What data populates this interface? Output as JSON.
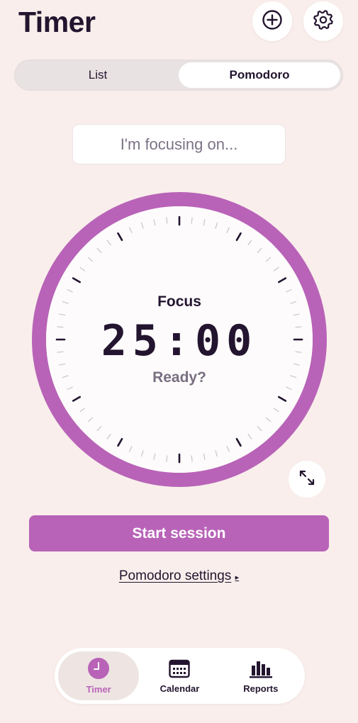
{
  "header": {
    "title": "Timer",
    "add_icon": "plus-circle-icon",
    "settings_icon": "gear-icon"
  },
  "mode_switch": {
    "options": [
      {
        "label": "List",
        "active": false
      },
      {
        "label": "Pomodoro",
        "active": true
      }
    ]
  },
  "focus_input": {
    "placeholder": "I'm focusing on...",
    "value": ""
  },
  "timer": {
    "phase": "Focus",
    "time": "25:00",
    "status": "Ready?",
    "ring_color": "#b863b8",
    "expand_icon": "expand-arrows-icon"
  },
  "actions": {
    "start_label": "Start session",
    "settings_link": "Pomodoro settings",
    "settings_link_arrow": "▸"
  },
  "tab_bar": {
    "items": [
      {
        "label": "Timer",
        "icon": "clock-icon",
        "active": true
      },
      {
        "label": "Calendar",
        "icon": "calendar-icon",
        "active": false
      },
      {
        "label": "Reports",
        "icon": "bar-chart-icon",
        "active": false
      }
    ]
  },
  "colors": {
    "background": "#f9eeeb",
    "accent": "#b863b8",
    "text": "#23152f",
    "muted": "#786f80"
  }
}
